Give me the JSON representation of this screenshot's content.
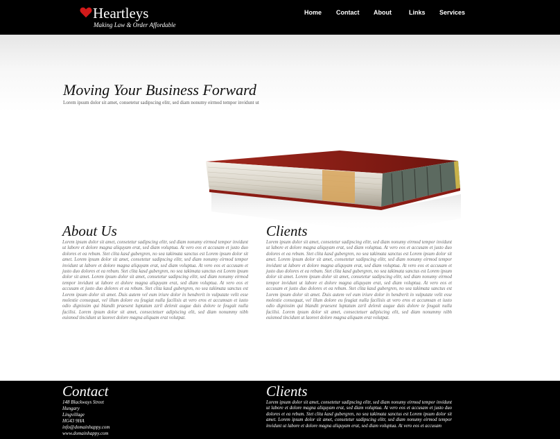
{
  "brand": {
    "name": "Heartleys",
    "tagline": "Making Law & Order Affordable",
    "heart_color": "#d11a1a"
  },
  "nav": {
    "items": [
      {
        "label": "Home"
      },
      {
        "label": "Contact"
      },
      {
        "label": "About"
      },
      {
        "label": "Links"
      },
      {
        "label": "Services"
      }
    ]
  },
  "hero": {
    "title": "Moving Your Business Forward",
    "subtitle": "Lorem ipsum dolor sit amet, consetetur sadipscing elitr, sed diam nonumy eirmod tempor invidunt ut",
    "image_icon": "book-image"
  },
  "about": {
    "heading": "About Us",
    "body": "Lorem ipsum dolor sit amet, consetetur sadipscing elitr, sed diam nonumy eirmod tempor invidunt ut labore et dolore magna aliquyam erat, sed diam voluptua. At vero eos et accusam et justo duo dolores et ea rebum. Stet clita kasd gubergren, no sea takimata sanctus est Lorem ipsum dolor sit amet. Lorem ipsum dolor sit amet, consetetur sadipscing elitr, sed diam nonumy eirmod tempor invidunt ut labore et dolore magna aliquyam erat, sed diam voluptua. At vero eos et accusam et justo duo dolores et ea rebum. Stet clita kasd gubergren, no sea takimata sanctus est Lorem ipsum dolor sit amet. Lorem ipsum dolor sit amet, consetetur sadipscing elitr, sed diam nonumy eirmod tempor invidunt ut labore et dolore magna aliquyam erat, sed diam voluptua. At vero eos et accusam et justo duo dolores et ea rebum. Stet clita kasd gubergren, no sea takimata sanctus est Lorem ipsum dolor sit amet. Duis autem vel eum iriure dolor in hendrerit in vulputate velit esse molestie consequat, vel illum dolore eu feugiat nulla facilisis at vero eros et accumsan et iusto odio dignissim qui blandit praesent luptatum zzril delenit augue duis dolore te feugait nulla facilisi. Lorem ipsum dolor sit amet, consectetuer adipiscing elit, sed diam nonummy nibh euismod tincidunt ut laoreet dolore magna aliquam erat volutpat."
  },
  "clients": {
    "heading": "Clients",
    "body": "Lorem ipsum dolor sit amet, consetetur sadipscing elitr, sed diam nonumy eirmod tempor invidunt ut labore et dolore magna aliquyam erat, sed diam voluptua. At vero eos et accusam et justo duo dolores et ea rebum. Stet clita kasd gubergren, no sea takimata sanctus est Lorem ipsum dolor sit amet. Lorem ipsum dolor sit amet, consetetur sadipscing elitr, sed diam nonumy eirmod tempor invidunt ut labore et dolore magna aliquyam erat, sed diam voluptua. At vero eos et accusam et justo duo dolores et ea rebum. Stet clita kasd gubergren, no sea takimata sanctus est Lorem ipsum dolor sit amet. Lorem ipsum dolor sit amet, consetetur sadipscing elitr, sed diam nonumy eirmod tempor invidunt ut labore et dolore magna aliquyam erat, sed diam voluptua. At vero eos et accusam et justo duo dolores et ea rebum. Stet clita kasd gubergren, no sea takimata sanctus est Lorem ipsum dolor sit amet. Duis autem vel eum iriure dolor in hendrerit in vulputate velit esse molestie consequat, vel illum dolore eu feugiat nulla facilisis at vero eros et accumsan et iusto odio dignissim qui blandit praesent luptatum zzril delenit augue duis dolore te feugait nulla facilisi. Lorem ipsum dolor sit amet, consectetuer adipiscing elit, sed diam nonummy nibh euismod tincidunt ut laoreet dolore magna aliquam erat volutpat."
  },
  "footer": {
    "contact_heading": "Contact",
    "address": [
      "148 Blackways Street",
      "Hungary",
      "Lingvillage",
      "HG43 9HA",
      "info@domainhappy.com",
      "www.domainhappy.com"
    ],
    "clients_heading": "Clients",
    "clients_body": "Lorem ipsum dolor sit amet, consetetur sadipscing elitr, sed diam nonumy eirmod tempor invidunt ut labore et dolore magna aliquyam erat, sed diam voluptua. At vero eos et accusam et justo duo dolores et ea rebum. Stet clita kasd gubergren, no sea takimata sanctus est Lorem ipsum dolor sit amet. Lorem ipsum dolor sit amet, consetetur sadipscing elitr, sed diam nonumy eirmod tempor invidunt ut labore et dolore magna aliquyam erat, sed diam voluptua. At vero eos et accusam"
  }
}
